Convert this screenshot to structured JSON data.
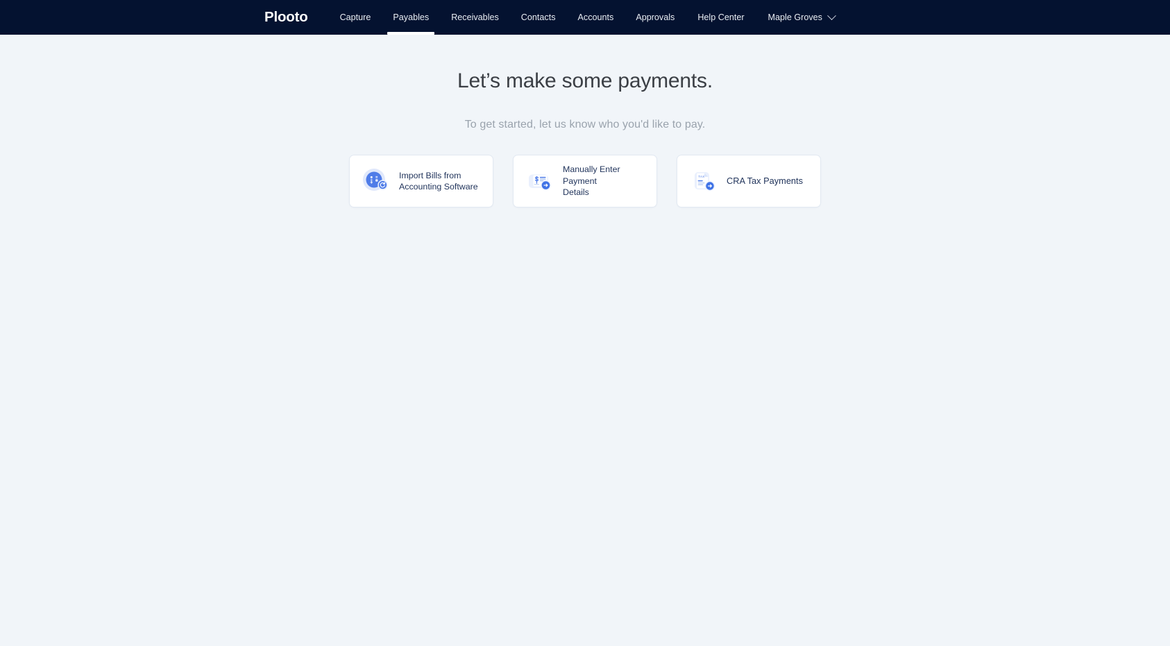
{
  "navbar": {
    "logo": "Plooto",
    "items": [
      {
        "label": "Capture",
        "name": "nav-item-capture",
        "active": false
      },
      {
        "label": "Payables",
        "name": "nav-item-payables",
        "active": true
      },
      {
        "label": "Receivables",
        "name": "nav-item-receivables",
        "active": false
      },
      {
        "label": "Contacts",
        "name": "nav-item-contacts",
        "active": false
      },
      {
        "label": "Accounts",
        "name": "nav-item-accounts",
        "active": false
      },
      {
        "label": "Approvals",
        "name": "nav-item-approvals",
        "active": false
      }
    ],
    "help_center": "Help Center",
    "organization": "Maple Groves",
    "chevron_icon": "chevron-down-icon",
    "background_color": "#041230",
    "active_indicator_color": "#ffffff"
  },
  "main": {
    "headline": "Let’s make some payments.",
    "subhead": "To get started, let us know who you'd like to pay.",
    "background_color": "#f1f5f9",
    "headline_color": "#3b3f45",
    "subhead_color": "#9aa3ad"
  },
  "cards": [
    {
      "label": "Import Bills from Accounting Software",
      "line1": "Import Bills from",
      "line2": "Accounting Software",
      "icon": "accounting-sync-icon",
      "badge_icon": "sync-arrow-icon",
      "name": "card-import-bills"
    },
    {
      "label": "Manually Enter Payment Details",
      "line1": "Manually Enter Payment",
      "line2": "Details",
      "icon": "cheque-dollar-icon",
      "badge_icon": "arrow-right-icon",
      "name": "card-manual-payment"
    },
    {
      "label": "CRA Tax Payments",
      "line1": "CRA Tax Payments",
      "line2": "",
      "icon": "tax-document-icon",
      "badge_icon": "arrow-right-icon",
      "name": "card-cra-tax"
    }
  ],
  "colors": {
    "accent_blue": "#4a7ae8",
    "icon_blue": "#4f7ce8",
    "icon_halo": "#dfe8fb",
    "card_border": "#e2e9f2",
    "card_text": "#22355c"
  }
}
